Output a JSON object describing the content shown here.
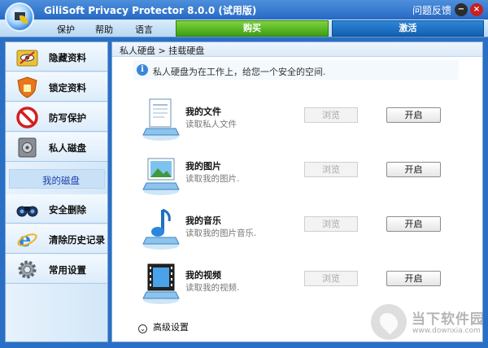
{
  "titlebar": {
    "title": "GiliSoft Privacy Protector 8.0.0 (试用版)",
    "help_label": "问题反馈",
    "minimize": "−",
    "close": "×"
  },
  "menu": {
    "items": [
      "保护",
      "帮助",
      "语言"
    ],
    "buy_label": "购买",
    "activate_label": "激活"
  },
  "sidebar": {
    "items": [
      {
        "label": "隐藏资料",
        "icon": "folder-hide-icon"
      },
      {
        "label": "锁定资料",
        "icon": "shield-lock-icon"
      },
      {
        "label": "防写保护",
        "icon": "no-entry-icon"
      },
      {
        "label": "私人磁盘",
        "icon": "safe-disk-icon"
      },
      {
        "label": "安全删除",
        "icon": "binoculars-icon"
      },
      {
        "label": "清除历史记录",
        "icon": "internet-explorer-icon"
      },
      {
        "label": "常用设置",
        "icon": "gear-icon"
      }
    ],
    "sub_item": "我的磁盘"
  },
  "content": {
    "breadcrumb": "私人硬盘 > 挂载硬盘",
    "info": "私人硬盘为在工作上，给您一个安全的空间.",
    "rows": [
      {
        "name": "我的文件",
        "desc": "读取私人文件",
        "browse": "浏览",
        "open": "开启",
        "icon": "document-icon"
      },
      {
        "name": "我的图片",
        "desc": "读取我的图片.",
        "browse": "浏览",
        "open": "开启",
        "icon": "picture-icon"
      },
      {
        "name": "我的音乐",
        "desc": "读取我的图片音乐.",
        "browse": "浏览",
        "open": "开启",
        "icon": "music-note-icon"
      },
      {
        "name": "我的视频",
        "desc": "读取我的视频.",
        "browse": "浏览",
        "open": "开启",
        "icon": "film-icon"
      }
    ],
    "advanced": "高级设置"
  },
  "watermark": {
    "name": "当下软件园",
    "url": "www.downxia.com"
  },
  "colors": {
    "titlebar": "#2e72c8",
    "buy": "#4fae1e",
    "activate": "#1a69bd",
    "sidebar_bg": "#dcecfa"
  }
}
